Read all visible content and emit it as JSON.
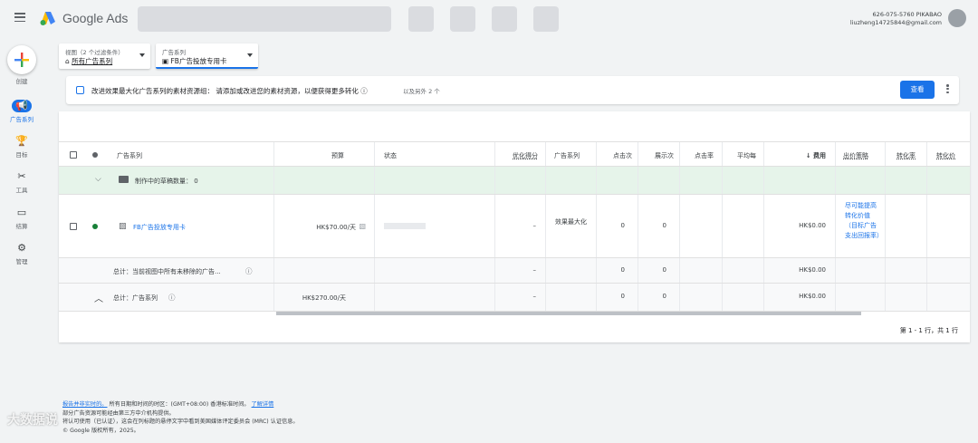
{
  "app": {
    "name": "Google Ads"
  },
  "account": {
    "id_line": "626-075-5760 PIKABAO",
    "email": "liuzheng14725844@gmail.com"
  },
  "nav": {
    "create": "创建",
    "items": [
      {
        "label": "广告系列",
        "icon": "megaphone-icon"
      },
      {
        "label": "目标",
        "icon": "trophy-icon"
      },
      {
        "label": "工具",
        "icon": "tools-icon"
      },
      {
        "label": "结算",
        "icon": "card-icon"
      },
      {
        "label": "管理",
        "icon": "gear-icon"
      }
    ]
  },
  "filters": {
    "view": {
      "small": "视图（2 个过滤条件）",
      "value": "所有广告系列"
    },
    "campaign": {
      "small": "广告系列",
      "value": "FB广告投放专用卡"
    }
  },
  "notice": {
    "text": "改进效果最大化广告系列的素材资源组：  请添加或改进您的素材资源，以便获得更多转化 ⓘ",
    "sub": "以及另外 2 个",
    "view_button": "查看"
  },
  "table": {
    "headers": {
      "campaign": "广告系列",
      "budget": "预算",
      "status": "状态",
      "opt_score": "优化得分",
      "campaign_type": "广告系列",
      "clicks": "点击次",
      "impressions": "展示次",
      "ctr": "点击率",
      "avg_cpc": "平均每",
      "cost": "↓ 费用",
      "bid_strategy": "出价策略",
      "conv_rate": "转化率",
      "conv_value": "转化价"
    },
    "draft_row": {
      "label": "制作中的草稿数量：",
      "count": "0"
    },
    "campaign_row": {
      "name": "FB广告投放专用卡",
      "budget": "HK$70.00/天",
      "opt_score": "–",
      "type": "效果最大化",
      "clicks": "0",
      "impressions": "0",
      "cost": "HK$0.00",
      "bid_strategy": "尽可能提高转化价值（目标广告支出回报率）"
    },
    "total_visible_row": {
      "label": "总计：当前视图中所有未移除的广告...",
      "opt_score": "–",
      "clicks": "0",
      "impressions": "0",
      "cost": "HK$0.00"
    },
    "total_all_row": {
      "label": "总计：广告系列",
      "budget": "HK$270.00/天",
      "opt_score": "–",
      "clicks": "0",
      "impressions": "0",
      "cost": "HK$0.00"
    },
    "pager": "第 1 - 1 行，共 1 行"
  },
  "footer": {
    "line1_link": "报告并非实时的。",
    "line1_rest": " 所有日期和时间的时区：(GMT+08:00) 香港标准时间。",
    "line1_link2": "了解详情",
    "line2": "部分广告资源可能经由第三方中介机构提供。",
    "line3": "将认可使用（已认证），这会在列标题的悬停文字中看到美国媒体评定委员会 (MRC) 认证信息。",
    "line4": "© Google 版权所有，2025。"
  },
  "watermark": "大数据说"
}
